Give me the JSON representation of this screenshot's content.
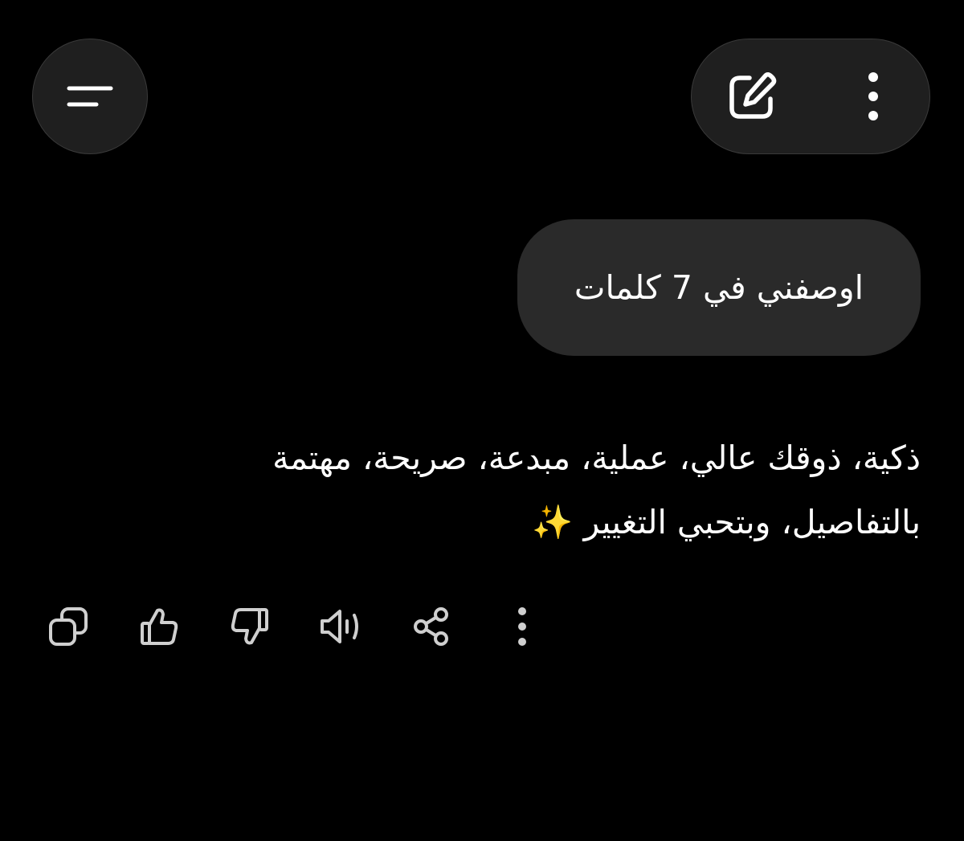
{
  "header": {
    "menu_icon": "sidebar-menu-icon",
    "edit_icon": "new-chat-edit-icon",
    "more_icon": "vertical-dots-icon"
  },
  "conversation": {
    "user_message": "اوصفني في 7 كلمات",
    "assistant_response": "ذكية، ذوقك عالي، عملية، مبدعة، صريحة، مهتمة بالتفاصيل، وبتحبي التغيير ✨"
  },
  "actions": [
    {
      "icon": "copy-icon"
    },
    {
      "icon": "thumbs-up-icon"
    },
    {
      "icon": "thumbs-down-icon"
    },
    {
      "icon": "read-aloud-icon"
    },
    {
      "icon": "share-icon"
    },
    {
      "icon": "more-options-icon"
    }
  ],
  "colors": {
    "background": "#000000",
    "bubble": "#2a2a2a",
    "button": "#1f1f1f",
    "icon": "#cfcfcf",
    "text": "#ffffff"
  }
}
